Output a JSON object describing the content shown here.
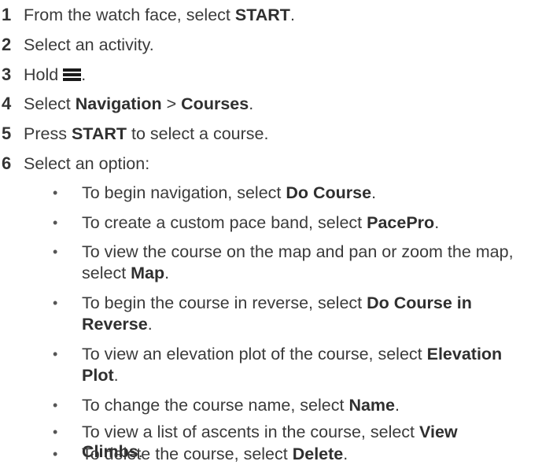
{
  "steps": [
    {
      "number": "1",
      "pre": "From the watch face, select ",
      "bold": "START",
      "post": "."
    },
    {
      "number": "2",
      "text": "Select an activity."
    },
    {
      "number": "3",
      "text": "Hold",
      "icon": "menu-icon",
      "post": "."
    },
    {
      "number": "4",
      "pre": "Select ",
      "bold1": "Navigation",
      "mid": " > ",
      "bold2": "Courses",
      "post": "."
    },
    {
      "number": "5",
      "pre": "Press ",
      "bold": "START",
      "post": " to select a course."
    },
    {
      "number": "6",
      "text": "Select an option:"
    }
  ],
  "options": [
    {
      "lines": [
        {
          "pre": "To begin navigation, select ",
          "bold": "Do Course",
          "post": "."
        }
      ]
    },
    {
      "lines": [
        {
          "pre": "To create a custom pace band, select ",
          "bold": "PacePro",
          "post": "."
        }
      ]
    },
    {
      "lines": [
        {
          "pre": "To view the course on the map and pan or zoom the map,",
          "bold": "",
          "post": ""
        },
        {
          "pre": "select ",
          "bold": "Map",
          "post": "."
        }
      ]
    },
    {
      "lines": [
        {
          "pre": "To begin the course in reverse, select ",
          "bold": "Do Course in",
          "post": ""
        },
        {
          "pre": "",
          "bold": "Reverse",
          "post": "."
        }
      ]
    },
    {
      "lines": [
        {
          "pre": "To view an elevation plot of the course, select ",
          "bold": "Elevation",
          "post": ""
        },
        {
          "pre": "",
          "bold": "Plot",
          "post": "."
        }
      ]
    },
    {
      "lines": [
        {
          "pre": "To change the course name, select ",
          "bold": "Name",
          "post": "."
        }
      ]
    },
    {
      "lines": [
        {
          "pre": "To view a list of ascents in the course, select ",
          "bold": "View",
          "post": ""
        },
        {
          "pre": "",
          "bold": "Climbs",
          "post": "."
        }
      ]
    },
    {
      "lines": [
        {
          "pre": "To delete the course, select ",
          "bold": "Delete",
          "post": "."
        }
      ]
    }
  ],
  "bullet_char": "•"
}
